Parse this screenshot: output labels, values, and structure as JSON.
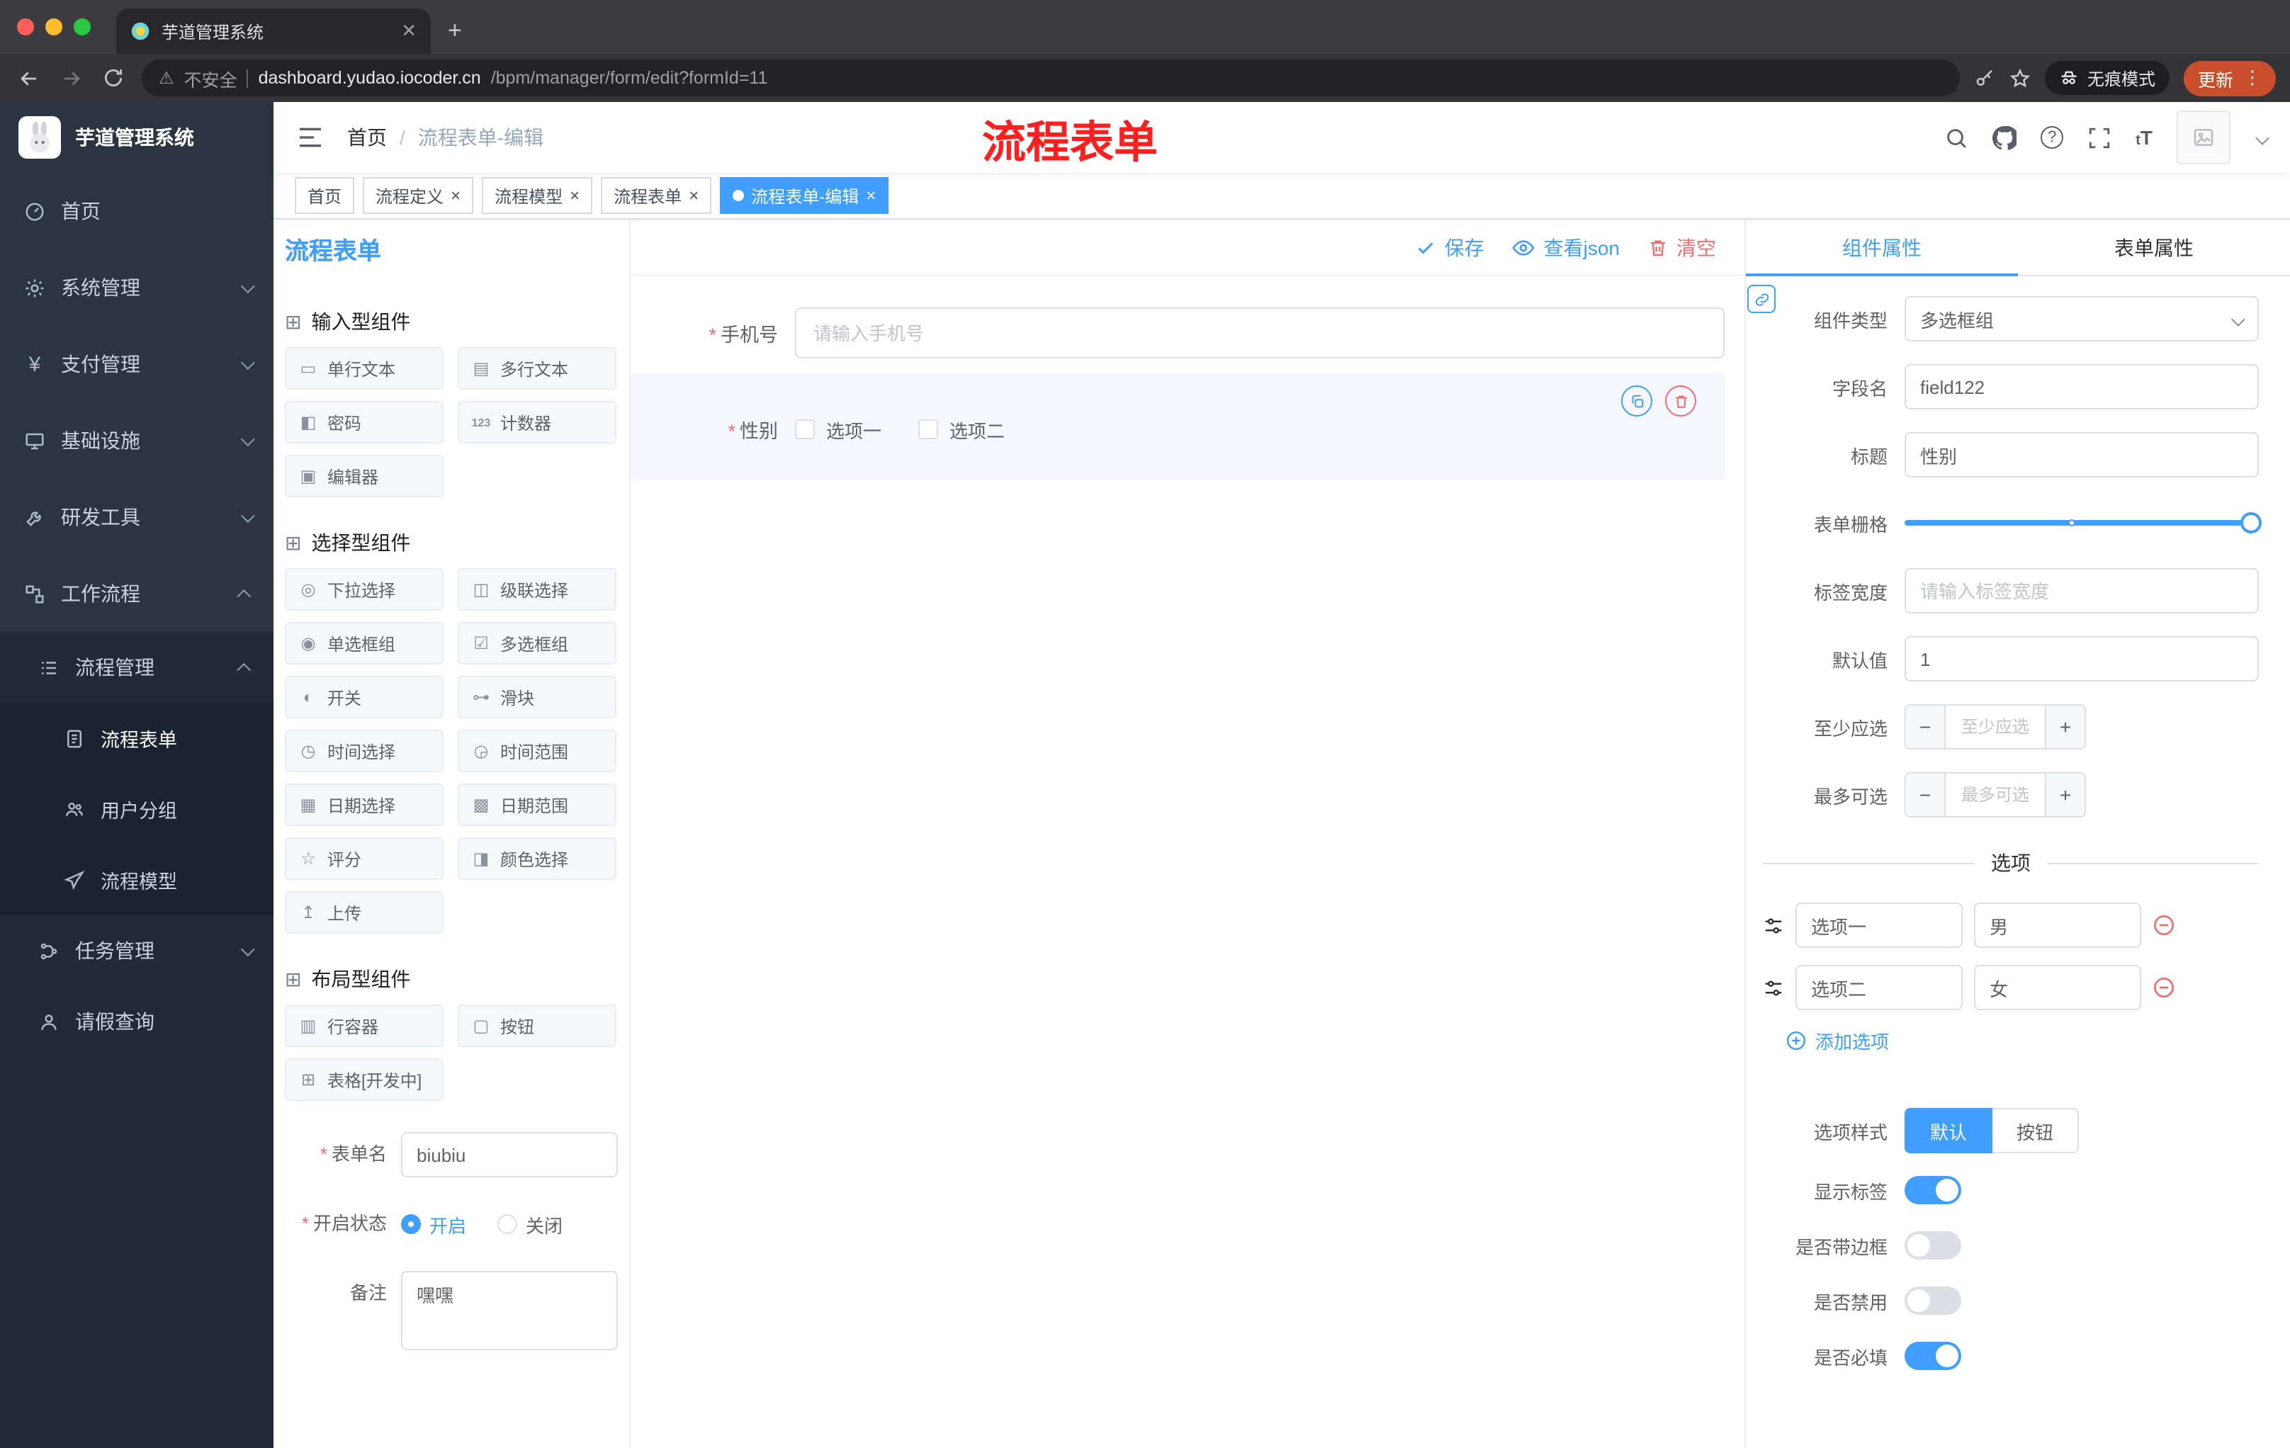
{
  "colors": {
    "accent": "#409eff",
    "danger": "#f56c6c",
    "annotation_red": "#ff1f1f",
    "update_pill": "#c94e2c",
    "sidebar_bg": "#2b3441",
    "active_tag": "#409eff"
  },
  "browser": {
    "tab_title": "芋道管理系统",
    "security": "不安全",
    "url_domain": "dashboard.yudao.iocoder.cn",
    "url_path": "/bpm/manager/form/edit?formId=11",
    "incognito": "无痕模式",
    "update": "更新"
  },
  "sidebar": {
    "title": "芋道管理系统",
    "items": [
      {
        "label": "首页"
      },
      {
        "label": "系统管理"
      },
      {
        "label": "支付管理"
      },
      {
        "label": "基础设施"
      },
      {
        "label": "研发工具"
      },
      {
        "label": "工作流程"
      },
      {
        "label": "流程管理"
      },
      {
        "label": "流程表单"
      },
      {
        "label": "用户分组"
      },
      {
        "label": "流程模型"
      },
      {
        "label": "任务管理"
      },
      {
        "label": "请假查询"
      }
    ]
  },
  "navbar": {
    "breadcrumb_home": "首页",
    "breadcrumb_sep": "/",
    "breadcrumb_current": "流程表单-编辑",
    "annotation": "流程表单"
  },
  "tags": [
    {
      "label": "首页"
    },
    {
      "label": "流程定义"
    },
    {
      "label": "流程模型"
    },
    {
      "label": "流程表单"
    },
    {
      "label": "流程表单-编辑"
    }
  ],
  "designer": {
    "panel_title": "流程表单",
    "save": "保存",
    "view_json": "查看json",
    "clear": "清空",
    "groups": [
      {
        "title": "输入型组件",
        "items": [
          {
            "label": "单行文本",
            "icon": "text-field-icon"
          },
          {
            "label": "多行文本",
            "icon": "textarea-icon"
          },
          {
            "label": "密码",
            "icon": "password-icon"
          },
          {
            "label": "计数器",
            "icon": "counter-icon"
          },
          {
            "label": "编辑器",
            "icon": "editor-icon"
          }
        ]
      },
      {
        "title": "选择型组件",
        "items": [
          {
            "label": "下拉选择",
            "icon": "select-icon"
          },
          {
            "label": "级联选择",
            "icon": "cascader-icon"
          },
          {
            "label": "单选框组",
            "icon": "radio-group-icon"
          },
          {
            "label": "多选框组",
            "icon": "checkbox-group-icon"
          },
          {
            "label": "开关",
            "icon": "switch-icon"
          },
          {
            "label": "滑块",
            "icon": "slider-icon"
          },
          {
            "label": "时间选择",
            "icon": "time-picker-icon"
          },
          {
            "label": "时间范围",
            "icon": "time-range-icon"
          },
          {
            "label": "日期选择",
            "icon": "date-picker-icon"
          },
          {
            "label": "日期范围",
            "icon": "date-range-icon"
          },
          {
            "label": "评分",
            "icon": "rate-icon"
          },
          {
            "label": "颜色选择",
            "icon": "color-picker-icon"
          },
          {
            "label": "上传",
            "icon": "upload-icon"
          }
        ]
      },
      {
        "title": "布局型组件",
        "items": [
          {
            "label": "行容器",
            "icon": "row-container-icon"
          },
          {
            "label": "按钮",
            "icon": "button-icon"
          },
          {
            "label": "表格[开发中]",
            "icon": "table-icon"
          }
        ]
      }
    ],
    "meta": {
      "name_label": "表单名",
      "name_value": "biubiu",
      "status_label": "开启状态",
      "status_on": "开启",
      "status_off": "关闭",
      "remark_label": "备注",
      "remark_value": "嘿嘿"
    },
    "canvas": {
      "phone_label": "手机号",
      "phone_placeholder": "请输入手机号",
      "gender_label": "性别",
      "gender_opt1": "选项一",
      "gender_opt2": "选项二"
    }
  },
  "props": {
    "tab_component": "组件属性",
    "tab_form": "表单属性",
    "type_label": "组件类型",
    "type_value": "多选框组",
    "field_label": "字段名",
    "field_value": "field122",
    "title_label": "标题",
    "title_value": "性别",
    "grid_label": "表单栅格",
    "width_label": "标签宽度",
    "width_placeholder": "请输入标签宽度",
    "default_label": "默认值",
    "default_value": "1",
    "min_label": "至少应选",
    "min_placeholder": "至少应选",
    "max_label": "最多可选",
    "max_placeholder": "最多可选",
    "options_title": "选项",
    "options": [
      {
        "label": "选项一",
        "value": "男"
      },
      {
        "label": "选项二",
        "value": "女"
      }
    ],
    "add_option": "添加选项",
    "style_label": "选项样式",
    "style_default": "默认",
    "style_button": "按钮",
    "toggle_show_label": "显示标签",
    "toggle_border": "是否带边框",
    "toggle_disabled": "是否禁用",
    "toggle_required": "是否必填"
  }
}
